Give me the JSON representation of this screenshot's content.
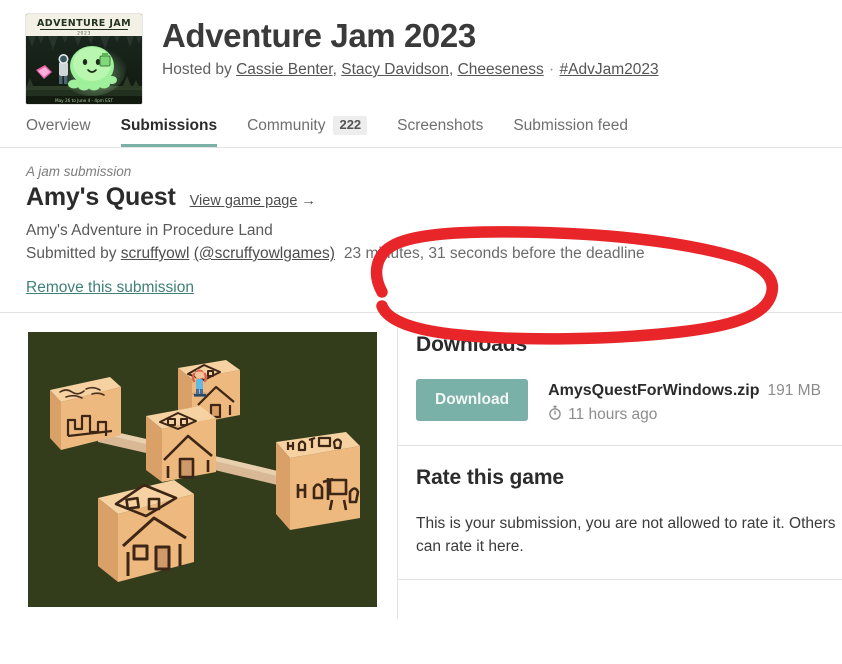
{
  "header": {
    "logo_alt": "Adventure Jam 2023 cover art",
    "logo_text_top": "ADVENTURE JAM",
    "logo_text_year": "2023",
    "logo_text_bottom": "May 26 to June 4 - 4pm EST",
    "title": "Adventure Jam 2023",
    "hosted_prefix": "Hosted by",
    "hosts": [
      "Cassie Benter",
      "Stacy Davidson",
      "Cheeseness"
    ],
    "separator": "·",
    "hashtag": "#AdvJam2023"
  },
  "tabs": [
    {
      "label": "Overview",
      "active": false,
      "badge": null
    },
    {
      "label": "Submissions",
      "active": true,
      "badge": null
    },
    {
      "label": "Community",
      "active": false,
      "badge": "222"
    },
    {
      "label": "Screenshots",
      "active": false,
      "badge": null
    },
    {
      "label": "Submission feed",
      "active": false,
      "badge": null
    }
  ],
  "submission": {
    "kicker": "A jam submission",
    "title": "Amy's Quest",
    "view_game_page": "View game page",
    "view_game_page_arrow": "→",
    "description": "Amy's Adventure in Procedure Land",
    "submitted_by_prefix": "Submitted by",
    "author": "scruffyowl",
    "author_handle": "(@scruffyowlgames)",
    "deadline_note": "23 minutes, 31 seconds before the deadline",
    "remove_link": "Remove this submission"
  },
  "annotation": {
    "shape": "hand-drawn-ellipse",
    "color": "#e8262a",
    "targets": "deadline_note"
  },
  "downloads": {
    "title": "Downloads",
    "button_label": "Download",
    "file_name": "AmysQuestForWindows.zip",
    "file_size": "191 MB",
    "uploaded_icon": "stopwatch-icon",
    "uploaded_ago": "11 hours ago"
  },
  "rate": {
    "title": "Rate this game",
    "body": "This is your submission, you are not allowed to rate it. Others can rate it here."
  },
  "colors": {
    "accent_teal": "#79b0a7",
    "link_teal": "#3f7f7a",
    "annotation_red": "#e8262a",
    "text_dark": "#2b2b2b",
    "text_muted": "#8c8c8c",
    "divider": "#e2e2e2",
    "game_shot_bg": "#333d1c",
    "game_shot_box": "#f0bd7f"
  }
}
